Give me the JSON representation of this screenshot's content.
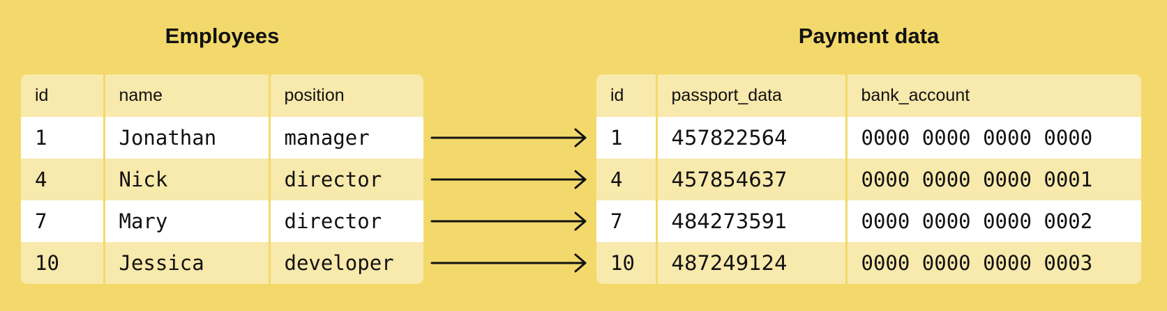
{
  "employees": {
    "title": "Employees",
    "columns": [
      "id",
      "name",
      "position"
    ],
    "rows": [
      [
        "1",
        "Jonathan",
        "manager"
      ],
      [
        "4",
        "Nick",
        "director"
      ],
      [
        "7",
        "Mary",
        "director"
      ],
      [
        "10",
        "Jessica",
        "developer"
      ]
    ]
  },
  "payment": {
    "title": "Payment data",
    "columns": [
      "id",
      "passport_data",
      "bank_account"
    ],
    "rows": [
      [
        "1",
        "457822564",
        "0000 0000 0000 0000"
      ],
      [
        "4",
        "457854637",
        "0000 0000 0000 0001"
      ],
      [
        "7",
        "484273591",
        "0000 0000 0000 0002"
      ],
      [
        "10",
        "487249124",
        "0000 0000 0000 0003"
      ]
    ]
  }
}
